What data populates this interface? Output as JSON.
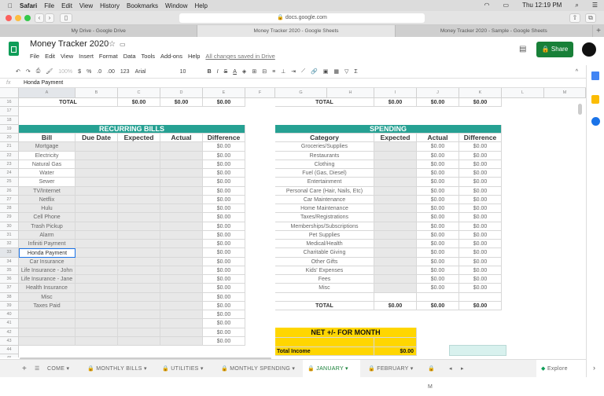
{
  "menubar": {
    "app": "Safari",
    "items": [
      "File",
      "Edit",
      "View",
      "History",
      "Bookmarks",
      "Window",
      "Help"
    ],
    "clock": "Thu 12:19 PM"
  },
  "browser": {
    "url": "docs.google.com",
    "tabs": [
      "My Drive - Google Drive",
      "Money Tracker 2020 - Google Sheets",
      "Money Tracker 2020 - Sample - Google Sheets"
    ],
    "active_tab": 1
  },
  "doc": {
    "title": "Money Tracker 2020",
    "menu": [
      "File",
      "Edit",
      "View",
      "Insert",
      "Format",
      "Data",
      "Tools",
      "Add-ons",
      "Help"
    ],
    "save_status": "All changes saved in Drive",
    "share": "Share"
  },
  "toolbar": {
    "zoom": "100%",
    "currency": "$",
    "percent": "%",
    "dec_less": ".0",
    "dec_more": ".00",
    "format": "123",
    "font": "Arial",
    "size": "10"
  },
  "formula": {
    "fx": "fx",
    "value": "Honda Payment"
  },
  "columns": [
    "A",
    "B",
    "C",
    "D",
    "E",
    "F",
    "G",
    "H",
    "I",
    "J",
    "K",
    "L",
    "M"
  ],
  "totals_row": {
    "label": "TOTAL",
    "values": [
      "$0.00",
      "$0.00",
      "$0.00"
    ],
    "right_values": [
      "$0.00",
      "$0.00",
      "$0.00"
    ]
  },
  "bills": {
    "title": "RECURRING BILLS",
    "headers": [
      "Bill",
      "Due Date",
      "Expected",
      "Actual",
      "Difference"
    ],
    "items": [
      "Mortgage",
      "Electricity",
      "Natural Gas",
      "Water",
      "Sewer",
      "TV/Internet",
      "Netflix",
      "Hulu",
      "Cell Phone",
      "Trash Pickup",
      "Alarm",
      "Infiniti Payment",
      "Honda Payment",
      "Car Insurance",
      "Life Insurance - John",
      "Life Insurance - Jane",
      "Health Insurance",
      "Misc",
      "Taxes Paid",
      "",
      "",
      "",
      ""
    ],
    "difference": "$0.00"
  },
  "spending": {
    "title": "SPENDING",
    "headers": [
      "Category",
      "Expected",
      "Actual",
      "Difference"
    ],
    "items": [
      "Groceries/Supplies",
      "Restaurants",
      "Clothing",
      "Fuel (Gas, Diesel)",
      "Entertainment",
      "Personal Care (Hair, Nails, Etc)",
      "Car Maintenance",
      "Home Maintenance",
      "Taxes/Registrations",
      "Memberships/Subscriptions",
      "Pet Supplies",
      "Medical/Health",
      "Charitable Giving",
      "Other Gifts",
      "Kids' Expenses",
      "Fees",
      "Misc"
    ],
    "value": "$0.00",
    "total_label": "TOTAL",
    "totals": [
      "$0.00",
      "$0.00",
      "$0.00"
    ]
  },
  "net": {
    "title": "NET +/- FOR MONTH",
    "income_label": "Total Income",
    "income_value": "$0.00"
  },
  "sheet_tabs": [
    "COME",
    "MONTHLY BILLS",
    "UTILITIES",
    "MONTHLY SPENDING",
    "JANUARY",
    "FEBRUARY",
    "M"
  ],
  "active_sheet": "JANUARY",
  "explore": "Explore",
  "colors": {
    "teal": "#26a193",
    "yellow": "#ffd600",
    "share": "#188038"
  }
}
